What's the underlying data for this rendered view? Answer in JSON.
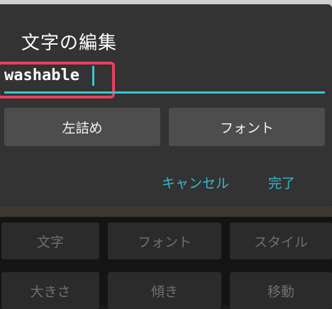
{
  "dialog": {
    "title": "文字の編集",
    "input_value": "washable",
    "buttons": {
      "left_align": "左詰め",
      "font": "フォント"
    },
    "actions": {
      "cancel": "キャンセル",
      "done": "完了"
    }
  },
  "toolbar": {
    "row1": [
      "文字",
      "フォント",
      "スタイル"
    ],
    "row2": [
      "大きさ",
      "傾き",
      "移動"
    ]
  },
  "colors": {
    "accent": "#37c8d0",
    "highlight": "#e8405e",
    "action_text": "#36b8cf",
    "dialog_bg": "#333333"
  }
}
